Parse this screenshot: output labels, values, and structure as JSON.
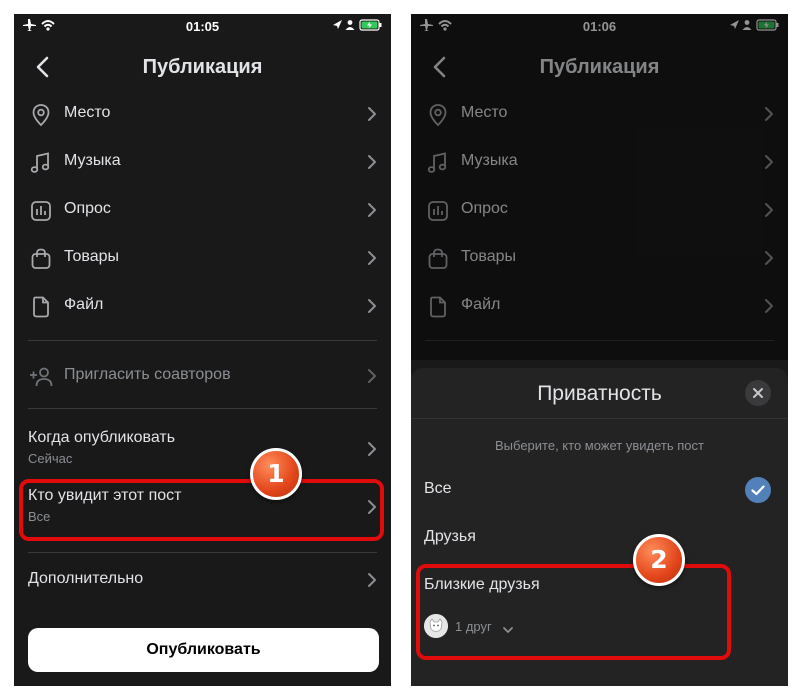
{
  "left_screen": {
    "status_time": "01:05",
    "title": "Публикация",
    "menu": [
      {
        "label": "Место",
        "icon": "location-pin-icon"
      },
      {
        "label": "Музыка",
        "icon": "music-note-icon"
      },
      {
        "label": "Опрос",
        "icon": "poll-icon"
      },
      {
        "label": "Товары",
        "icon": "shopping-bag-icon"
      },
      {
        "label": "Файл",
        "icon": "file-icon"
      }
    ],
    "invite": {
      "label": "Пригласить соавторов",
      "icon": "add-user-icon"
    },
    "when": {
      "label": "Когда опубликовать",
      "value": "Сейчас"
    },
    "who": {
      "label": "Кто увидит этот пост",
      "value": "Все"
    },
    "extra": {
      "label": "Дополнительно"
    },
    "publish_button": "Опубликовать",
    "step_badge": "1"
  },
  "right_screen": {
    "status_time": "01:06",
    "title": "Публикация",
    "menu": [
      {
        "label": "Место",
        "icon": "location-pin-icon"
      },
      {
        "label": "Музыка",
        "icon": "music-note-icon"
      },
      {
        "label": "Опрос",
        "icon": "poll-icon"
      },
      {
        "label": "Товары",
        "icon": "shopping-bag-icon"
      },
      {
        "label": "Файл",
        "icon": "file-icon"
      }
    ],
    "sheet": {
      "title": "Приватность",
      "subtitle": "Выберите, кто может увидеть пост",
      "options": [
        {
          "label": "Все",
          "selected": true
        },
        {
          "label": "Друзья",
          "selected": false
        },
        {
          "label": "Близкие друзья",
          "selected": false
        }
      ],
      "close_friends_count": "1 друг"
    },
    "step_badge": "2"
  },
  "colors": {
    "background": "#19191a",
    "text": "#e1e3e6",
    "secondary_text": "#8b8e92",
    "highlight": "#e10b0b",
    "badge": "#e2451a",
    "check": "#5181b8"
  }
}
